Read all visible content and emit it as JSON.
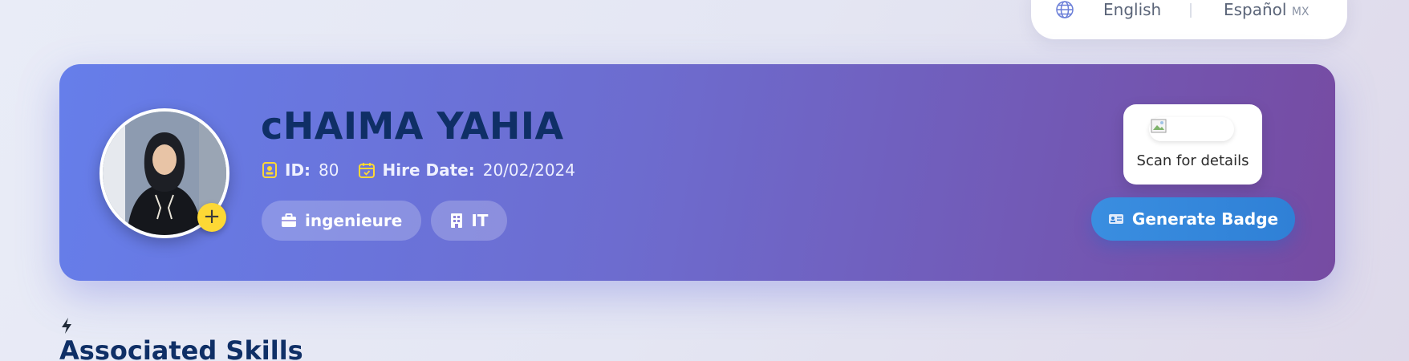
{
  "language_switcher": {
    "english_label": "English",
    "spanish_label": "Español",
    "spanish_region": "MX"
  },
  "profile": {
    "name": "cHAIMA YAHIA",
    "id_label": "ID:",
    "id_value": "80",
    "hire_date_label": "Hire Date:",
    "hire_date_value": "20/02/2024",
    "position": "ingenieure",
    "department": "IT",
    "add_photo_symbol": "+"
  },
  "qr": {
    "caption": "Scan for details"
  },
  "actions": {
    "generate_badge_label": "Generate Badge"
  },
  "skills": {
    "heading": "Associated Skills"
  },
  "colors": {
    "card_gradient_start": "#667eea",
    "card_gradient_end": "#764ba2",
    "name_color": "#0f2f66",
    "accent_yellow": "#fdd835",
    "button_blue": "#3a8ee0"
  },
  "icons": {
    "language": "globe-icon",
    "id": "id-card-icon",
    "hire_date": "calendar-icon",
    "position": "briefcase-icon",
    "department": "building-icon",
    "badge": "badge-icon",
    "skills": "bolt-icon",
    "add_photo": "plus-icon"
  }
}
